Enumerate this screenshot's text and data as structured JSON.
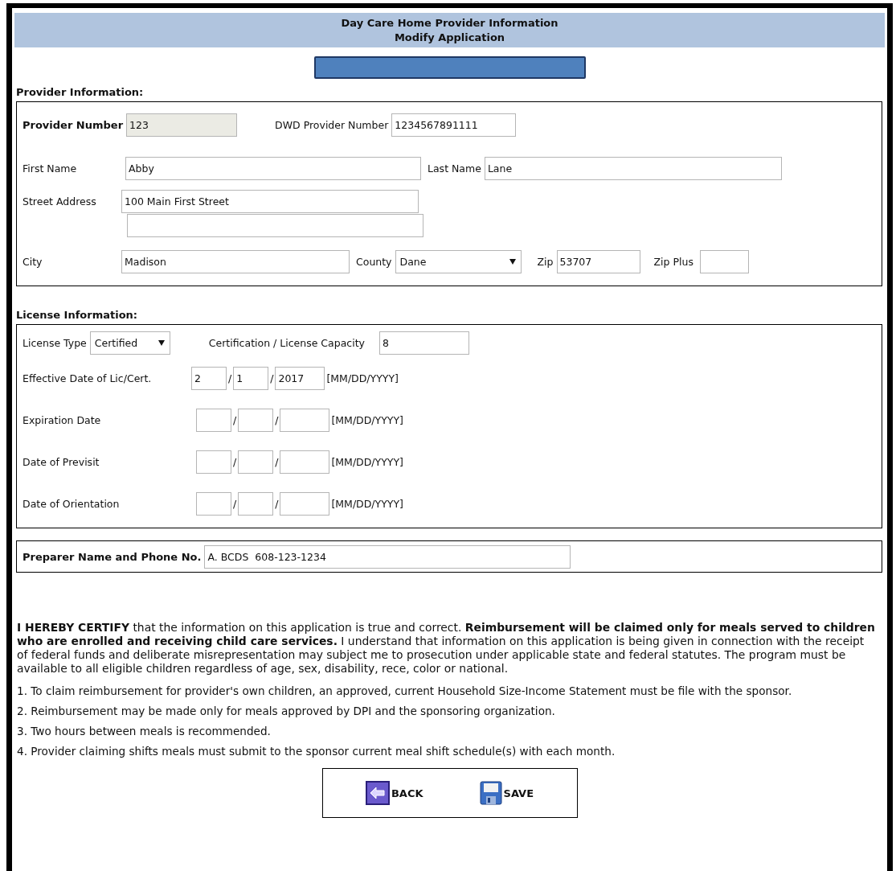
{
  "header": {
    "title": "Day Care Home Provider Information",
    "subtitle": "Modify Application"
  },
  "provider": {
    "heading": "Provider Information:",
    "provider_number": {
      "label": "Provider Number",
      "value": "123",
      "disabled": true
    },
    "dwd_provider_number": {
      "label": "DWD Provider Number",
      "value": "1234567891111"
    },
    "first_name": {
      "label": "First Name",
      "value": "Abby"
    },
    "last_name": {
      "label": "Last Name",
      "value": "Lane"
    },
    "street_address": {
      "label": "Street Address",
      "value": "100 Main First Street"
    },
    "city": {
      "label": "City",
      "value": "Madison"
    },
    "county": {
      "label": "County",
      "value": "Dane"
    },
    "zip": {
      "label": "Zip",
      "value": "53707"
    },
    "zip_plus": {
      "label": "Zip Plus"
    }
  },
  "license": {
    "heading": "License Information:",
    "license_type": {
      "label": "License Type",
      "value": "Certified"
    },
    "capacity": {
      "label": "Certification / License Capacity",
      "value": "8"
    },
    "dates": [
      {
        "label": "Effective Date of Lic/Cert.",
        "parts": [
          {
            "kind": "month",
            "value": "2"
          },
          {
            "kind": "day",
            "value": "1"
          },
          {
            "kind": "year",
            "value": "2017"
          }
        ],
        "separators": [
          "/",
          "/"
        ],
        "format": "[MM/DD/YYYY]"
      },
      {
        "label": "Expiration Date",
        "parts": [
          {
            "kind": "month"
          },
          {
            "kind": "day"
          },
          {
            "kind": "year"
          }
        ],
        "separators": [
          "/",
          "/"
        ],
        "format": "[MM/DD/YYYY]"
      },
      {
        "label": "Date of Previsit",
        "parts": [
          {
            "kind": "month"
          },
          {
            "kind": "day"
          },
          {
            "kind": "year"
          }
        ],
        "separators": [
          "/",
          "/"
        ],
        "format": "[MM/DD/YYYY]"
      },
      {
        "label": "Date of Orientation",
        "parts": [
          {
            "kind": "month"
          },
          {
            "kind": "day"
          },
          {
            "kind": "year"
          }
        ],
        "separators": [
          "/",
          "/"
        ],
        "format": "[MM/DD/YYYY]"
      }
    ]
  },
  "preparer": {
    "label": "Preparer Name and Phone No.",
    "value": "A. BCDS  608-123-1234"
  },
  "certification": "**I HEREBY CERTIFY** that the information on this application is true and correct. **Reimbursement will be claimed only for meals served to children who are enrolled and receiving child care services.** I understand that information on this application is being given in connection with the receipt of federal funds and deliberate misrepresentation may subject me to prosecution under applicable state and federal statutes. The program must be available to all eligible children regardless of age, sex, disability, rece, color or national.",
  "notes": [
    "1. To claim reimbursement for provider's own children, an approved, current Household Size-Income Statement must be file with the sponsor.",
    "2. Reimbursement may be made only for meals approved by DPI and the sponsoring organization.",
    "3. Two hours between meals is recommended.",
    "4. Provider claiming shifts meals must submit to the sponsor current meal shift schedule(s) with each month."
  ],
  "buttons": [
    {
      "kind": "back",
      "label": "BACK"
    },
    {
      "kind": "save",
      "label": "SAVE"
    }
  ]
}
